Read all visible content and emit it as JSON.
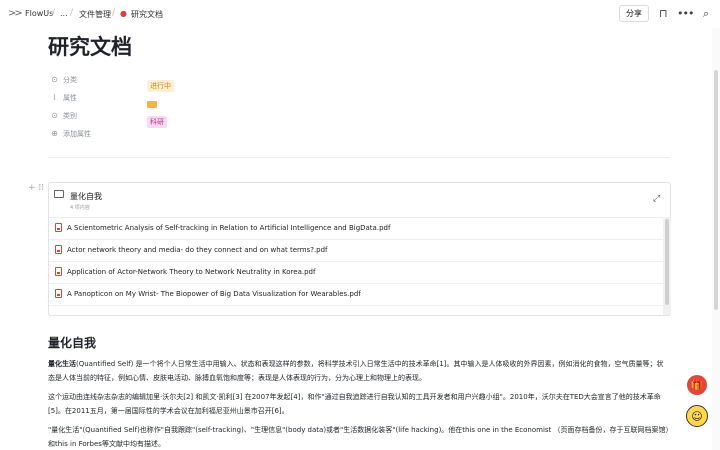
{
  "topbar": {
    "breadcrumbs": [
      "FlowUs",
      "...",
      "文件管理",
      "研究文档"
    ],
    "share_label": "分享"
  },
  "page": {
    "title": "研究文档"
  },
  "properties": [
    {
      "name": "分类",
      "value": "进行中"
    },
    {
      "name": "属性",
      "value": ""
    },
    {
      "name": "类别",
      "value": "科研"
    }
  ],
  "add_property_label": "添加属性",
  "database": {
    "title": "量化自我",
    "count": "4 项内容",
    "files": [
      "A Scientometric Analysis of Self-tracking in Relation to Artificial Intelligence and BigData.pdf",
      "Actor network theory and media- do they connect and on what terms?.pdf",
      "Application of Actor-Network Theory to Network Neutrality in Korea.pdf",
      "A Panopticon on My Wrist- The Biopower of Big Data Visualization for Wearables.pdf"
    ]
  },
  "article": {
    "heading": "量化自我",
    "p1_bold": "量化生活",
    "p1_rest": "(Quantified Self) 是一个将个人日常生活中用输入、状态和表现这样的参数，将科学技术引入日常生活中的技术革命[1]。其中输入是人体吸收的外界因素，例如消化的食物，空气质量等；状态是人体当前的特征，例如心情、皮肤电活动、脉搏血氧饱和度等；表现是人体表现的行为，分为心理上和物理上的表现。",
    "p2": "这个运动由连线杂志杂志的编辑加里·沃尔夫[2] 和凯文·凯利[3] 在2007年发起[4]，和作\"通过自我追踪进行自我认知的工具开发者和用户兴趣小组\"。2010年，沃尔夫在TED大会宣言了他的技术革命[5]。在2011五月，第一届国际性的学术会议在加利福尼亚州山景市召开[6]。",
    "p3": "\"量化生活\"(Quantified Self)也称作\"自我跟踪\"(self-tracking)、\"生理信息\"(body data)或者\"生活数据化装客\"(life hacking)。他在this one in the Economist （页面存档备份，存于互联网档案馆）和this in Forbes等文献中均有描述。"
  },
  "colors": {
    "tag_status_bg": "#fdf0d2",
    "tag_category_bg": "#f8d9ef",
    "pdf_red": "#d64541"
  }
}
